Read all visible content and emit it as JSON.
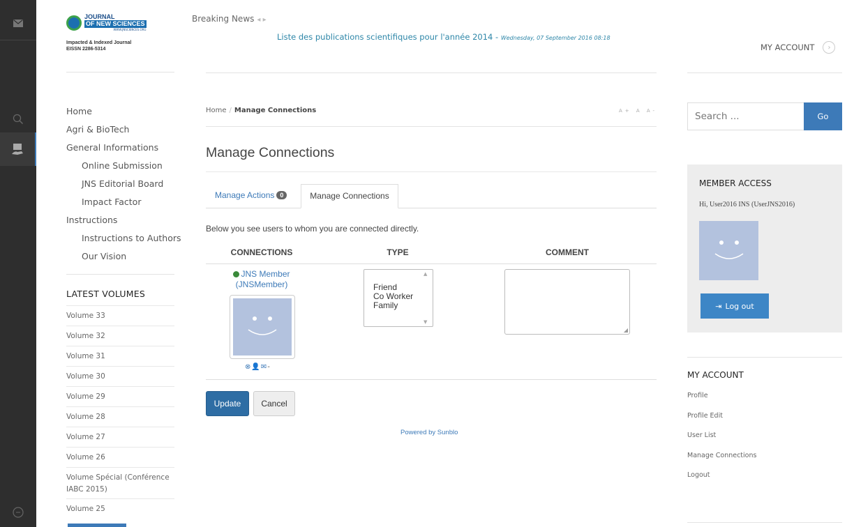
{
  "logo": {
    "line1": "JOURNAL",
    "line2": "OF NEW SCIENCES",
    "line3": "WWW.JNSCIENCES.ORG",
    "tagline1": "Impacted & Indexed Journal",
    "tagline2": "EISSN 2286-5314"
  },
  "header": {
    "breaking_label": "Breaking News",
    "ticker_text": "Liste des publications scientifiques pour l'année 2014 -",
    "ticker_date": "Wednesday, 07 September 2016 08:18",
    "my_account": "MY ACCOUNT"
  },
  "nav": {
    "items": [
      {
        "label": "Home",
        "sub": false
      },
      {
        "label": "Agri & BioTech",
        "sub": false
      },
      {
        "label": "General Informations",
        "sub": false
      },
      {
        "label": "Online Submission",
        "sub": true
      },
      {
        "label": "JNS Editorial Board",
        "sub": true
      },
      {
        "label": "Impact Factor",
        "sub": true
      },
      {
        "label": "Instructions",
        "sub": false
      },
      {
        "label": "Instructions to Authors",
        "sub": true
      },
      {
        "label": "Our Vision",
        "sub": true
      }
    ]
  },
  "latest_volumes": {
    "title": "LATEST VOLUMES",
    "items": [
      "Volume 33",
      "Volume 32",
      "Volume 31",
      "Volume 30",
      "Volume 29",
      "Volume 28",
      "Volume 27",
      "Volume 26",
      "Volume Spécial (Conférence IABC 2015)",
      "Volume 25"
    ]
  },
  "breadcrumb": {
    "home": "Home",
    "separator": "/",
    "current": "Manage Connections",
    "font_controls": "A+ A A-"
  },
  "page": {
    "title": "Manage Connections",
    "tab_actions": "Manage Actions",
    "tab_actions_count": "0",
    "tab_connections": "Manage Connections",
    "description": "Below you see users to whom you are connected directly."
  },
  "table": {
    "headers": [
      "CONNECTIONS",
      "TYPE",
      "COMMENT"
    ],
    "member_name": "JNS Member",
    "member_username": "(JNSMember)",
    "mini_dash": "-",
    "type_options": [
      "Friend",
      "Co Worker",
      "Family"
    ],
    "comment_value": ""
  },
  "buttons": {
    "update": "Update",
    "cancel": "Cancel"
  },
  "footer": {
    "powered": "Powered by Sunblo"
  },
  "sidebar": {
    "search_placeholder": "Search ...",
    "search_go": "Go",
    "member_access_title": "MEMBER ACCESS",
    "greeting": "Hi, User2016 INS (UserJNS2016)",
    "logout_label": "Log out",
    "my_account_title": "MY ACCOUNT",
    "my_account_links": [
      "Profile",
      "Profile Edit",
      "User List",
      "Manage Connections",
      "Logout"
    ]
  },
  "colors": {
    "accent": "#3d7ab8",
    "rail": "#2e2e2e",
    "avatar": "#b3c2de",
    "online_dot": "#3a8a3a"
  }
}
